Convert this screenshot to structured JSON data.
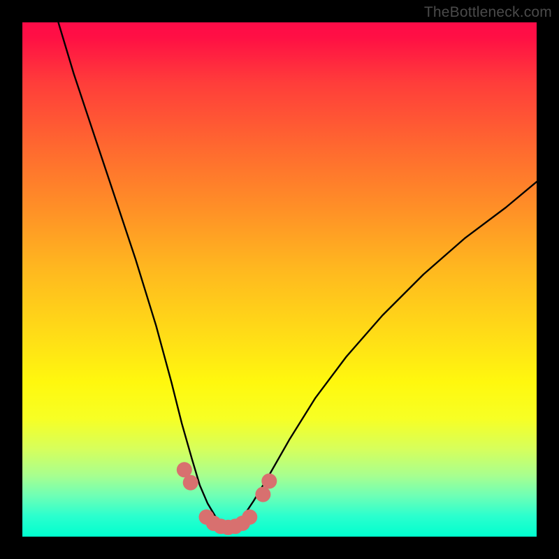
{
  "watermark": "TheBottleneck.com",
  "chart_data": {
    "type": "line",
    "title": "",
    "xlabel": "",
    "ylabel": "",
    "xlim": [
      0,
      100
    ],
    "ylim": [
      0,
      100
    ],
    "gradient_stops": [
      {
        "pct": 0,
        "color": "#ff0b48"
      },
      {
        "pct": 12,
        "color": "#ff3e3a"
      },
      {
        "pct": 25,
        "color": "#ff6b2f"
      },
      {
        "pct": 48,
        "color": "#ffb81f"
      },
      {
        "pct": 70,
        "color": "#fff80e"
      },
      {
        "pct": 88,
        "color": "#a9ff8e"
      },
      {
        "pct": 100,
        "color": "#00ffcf"
      }
    ],
    "series": [
      {
        "name": "left-curve",
        "color": "#000000",
        "x": [
          7,
          10,
          14,
          18,
          22,
          26,
          29,
          31,
          33,
          34.5,
          36,
          37.5,
          39,
          40
        ],
        "y": [
          100,
          90,
          78,
          66,
          54,
          41,
          30,
          22,
          15,
          10,
          6.5,
          4,
          2.2,
          1.5
        ]
      },
      {
        "name": "right-curve",
        "color": "#000000",
        "x": [
          40,
          41.5,
          43,
          45,
          48,
          52,
          57,
          63,
          70,
          78,
          86,
          94,
          100
        ],
        "y": [
          1.5,
          2.2,
          4,
          7,
          12,
          19,
          27,
          35,
          43,
          51,
          58,
          64,
          69
        ]
      },
      {
        "name": "highlight-beads",
        "color": "#d8706f",
        "type": "scatter",
        "x": [
          31.5,
          32.7,
          35.8,
          37.2,
          38.6,
          40.0,
          41.4,
          42.8,
          44.2,
          46.8,
          48.0
        ],
        "y": [
          13.0,
          10.5,
          3.8,
          2.6,
          2.0,
          1.8,
          2.0,
          2.6,
          3.8,
          8.2,
          10.8
        ]
      }
    ]
  }
}
